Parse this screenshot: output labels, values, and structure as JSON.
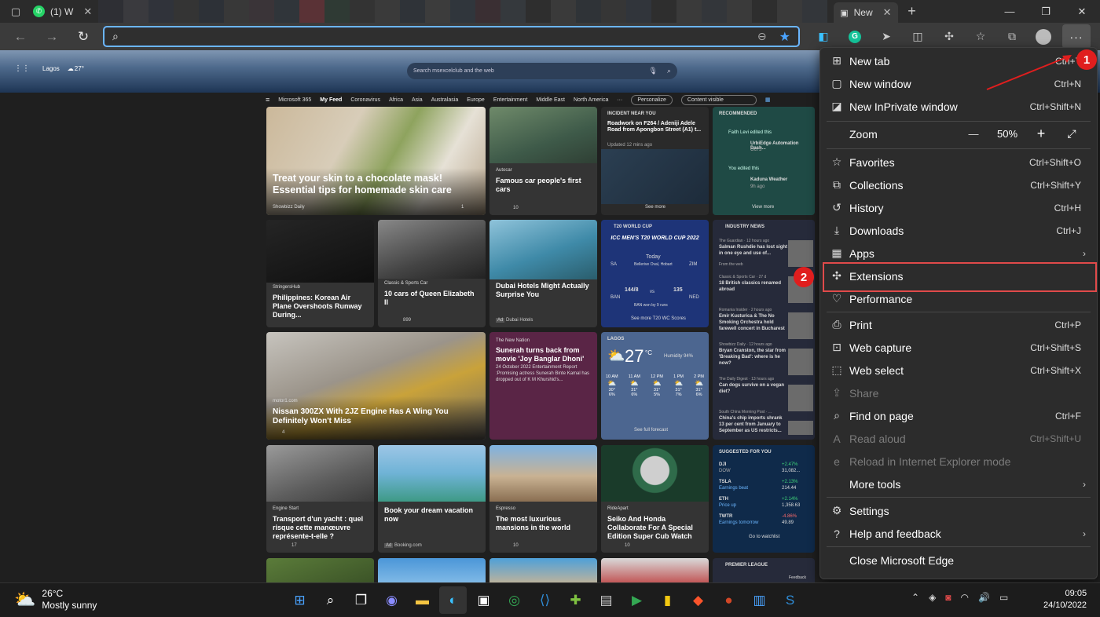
{
  "tabs": {
    "whatsapp": "(1) W",
    "active": "New"
  },
  "address": {
    "placeholder": ""
  },
  "ntp": {
    "location": "Lagos",
    "temp": "27°",
    "search_placeholder": "Search msexcelclub and the web",
    "feed_nav": [
      "Microsoft 365",
      "My Feed",
      "Coronavirus",
      "Africa",
      "Asia",
      "Australasia",
      "Europe",
      "Entertainment",
      "Middle East",
      "North America"
    ],
    "personalize": "Personalize",
    "content_visible": "Content visible",
    "cards": {
      "c1": {
        "title": "Treat your skin to a chocolate mask! Essential tips for homemade skin care",
        "source": "Showbizz Daily",
        "meta": "1"
      },
      "c2": {
        "title": "Famous car people's first cars",
        "source": "Autocar",
        "meta": "10"
      },
      "c3": {
        "label": "INCIDENT NEAR YOU",
        "title": "Roadwork on F264 / Adeniji Adele Road from Apongbon Street (A1) t...",
        "time": "Updated 12 mins ago",
        "more": "See more"
      },
      "c4": {
        "label": "RECOMMENDED",
        "l1": "Faith Levi edited this",
        "t1": "UrbiEdge Automation Dash...",
        "d1": "Oct 5",
        "l2": "You edited this",
        "t2": "Kaduna Weather",
        "d2": "9h ago",
        "more": "View more"
      },
      "c5": {
        "title": "Philippines: Korean Air Plane Overshoots Runway During...",
        "source": "StringersHub"
      },
      "c6": {
        "title": "10 cars of Queen Elizabeth II",
        "source": "Classic & Sports Car",
        "meta": "899"
      },
      "c7": {
        "title": "Dubai Hotels Might Actually Surprise You",
        "source": "Dubai Hotels",
        "ad": "Ad"
      },
      "c8": {
        "label": "T20 WORLD CUP",
        "heading": "ICC MEN'S T20 WORLD CUP 2022",
        "sa": "SA",
        "zim": "ZIM",
        "today": "Today",
        "venue": "Bellerive Oval, Hobart",
        "ban": "BAN",
        "ned": "NED",
        "s1": "144/8",
        "s2": "135",
        "vs": "vs",
        "result": "BAN won by 9 runs",
        "more": "See more T20 WC Scores"
      },
      "c9": {
        "label": "INDUSTRY NEWS",
        "s1": "The Guardian · 12 hours ago",
        "t1": "Salman Rushdie has lost sight in one eye and use of...",
        "f1": "From the web",
        "s2": "Classic & Sports Car · 27 d",
        "t2": "18 British classics renamed abroad",
        "s3": "Romania Insider · 2 hours ago",
        "t3": "Emir Kusturica & The No Smoking Orchestra hold farewell concert in Bucharest",
        "s4": "Showbizz Daily · 12 hours ago",
        "t4": "Bryan Cranston, the star from 'Breaking Bad': where is he now?",
        "s5": "The Daily Digest · 13 hours ago",
        "t5": "Can dogs survive on a vegan diet?",
        "s6": "South China Morning Post · ...",
        "t6": "China's chip imports shrank 13 per cent from January to September as US restricts..."
      },
      "c10": {
        "title": "Nissan 300ZX With 2JZ Engine Has A Wing You Definitely Won't Miss",
        "source": "motor1.com",
        "meta": "4"
      },
      "c11": {
        "title": "Sunerah turns back from movie 'Joy Banglar Dhoni'",
        "source": "The New Nation",
        "body": "24 October 2022 Entertainment Report :Promising actress Sunerah Binte Kamal has dropped out of K M Khurshid's..."
      },
      "c12": {
        "label": "LAGOS",
        "temp": "27",
        "unit": "°C",
        "humidity": "Humidity 94%",
        "hours": [
          "10 AM",
          "11 AM",
          "12 PM",
          "1 PM",
          "2 PM"
        ],
        "temps": [
          "30°",
          "31°",
          "31°",
          "31°",
          "31°"
        ],
        "rain": [
          "6%",
          "6%",
          "5%",
          "7%",
          "6%"
        ],
        "more": "See full forecast"
      },
      "c13": {
        "title": "Transport d'un yacht : quel risque cette manœuvre représente-t-elle ?",
        "source": "Engine Start",
        "meta": "17"
      },
      "c14": {
        "title": "Book your dream vacation now",
        "source": "Booking.com",
        "ad": "Ad"
      },
      "c15": {
        "title": "The most luxurious mansions in the world",
        "source": "Espresso",
        "meta": "10"
      },
      "c16": {
        "title": "Seiko And Honda Collaborate For A Special Edition Super Cub Watch",
        "source": "RideApart",
        "meta": "10"
      },
      "c17": {
        "label": "SUGGESTED FOR YOU",
        "rows": [
          {
            "sym": "DJI",
            "sub": "DOW",
            "chg": "+2.47%",
            "val": "31,082..."
          },
          {
            "sym": "TSLA",
            "sub": "Earnings beat",
            "chg": "+2.13%",
            "val": "214.44"
          },
          {
            "sym": "ETH",
            "sub": "Price up",
            "chg": "+2.14%",
            "val": "1,358.63"
          },
          {
            "sym": "TWTR",
            "sub": "Earnings tomorrow",
            "chg": "-4.86%",
            "val": "49.89"
          }
        ],
        "more": "Go to watchlist"
      },
      "c18": {
        "label": "PREMIER LEAGUE"
      },
      "feedback": "Feedback"
    }
  },
  "menu": {
    "items": {
      "new_tab": {
        "label": "New tab",
        "shortcut": "Ctrl+T"
      },
      "new_window": {
        "label": "New window",
        "shortcut": "Ctrl+N"
      },
      "inprivate": {
        "label": "New InPrivate window",
        "shortcut": "Ctrl+Shift+N"
      },
      "zoom": {
        "label": "Zoom",
        "minus": "—",
        "value": "50%",
        "plus": "+"
      },
      "favorites": {
        "label": "Favorites",
        "shortcut": "Ctrl+Shift+O"
      },
      "collections": {
        "label": "Collections",
        "shortcut": "Ctrl+Shift+Y"
      },
      "history": {
        "label": "History",
        "shortcut": "Ctrl+H"
      },
      "downloads": {
        "label": "Downloads",
        "shortcut": "Ctrl+J"
      },
      "apps": {
        "label": "Apps"
      },
      "extensions": {
        "label": "Extensions"
      },
      "performance": {
        "label": "Performance"
      },
      "print": {
        "label": "Print",
        "shortcut": "Ctrl+P"
      },
      "web_capture": {
        "label": "Web capture",
        "shortcut": "Ctrl+Shift+S"
      },
      "web_select": {
        "label": "Web select",
        "shortcut": "Ctrl+Shift+X"
      },
      "share": {
        "label": "Share"
      },
      "find": {
        "label": "Find on page",
        "shortcut": "Ctrl+F"
      },
      "read_aloud": {
        "label": "Read aloud",
        "shortcut": "Ctrl+Shift+U"
      },
      "ie_mode": {
        "label": "Reload in Internet Explorer mode"
      },
      "more_tools": {
        "label": "More tools"
      },
      "settings": {
        "label": "Settings"
      },
      "help": {
        "label": "Help and feedback"
      },
      "close": {
        "label": "Close Microsoft Edge"
      }
    }
  },
  "annotations": {
    "badge1": "1",
    "badge2": "2",
    "accent": "#e01e1e"
  },
  "taskbar": {
    "temp": "26°C",
    "condition": "Mostly sunny",
    "time": "09:05",
    "date": "24/10/2022"
  }
}
